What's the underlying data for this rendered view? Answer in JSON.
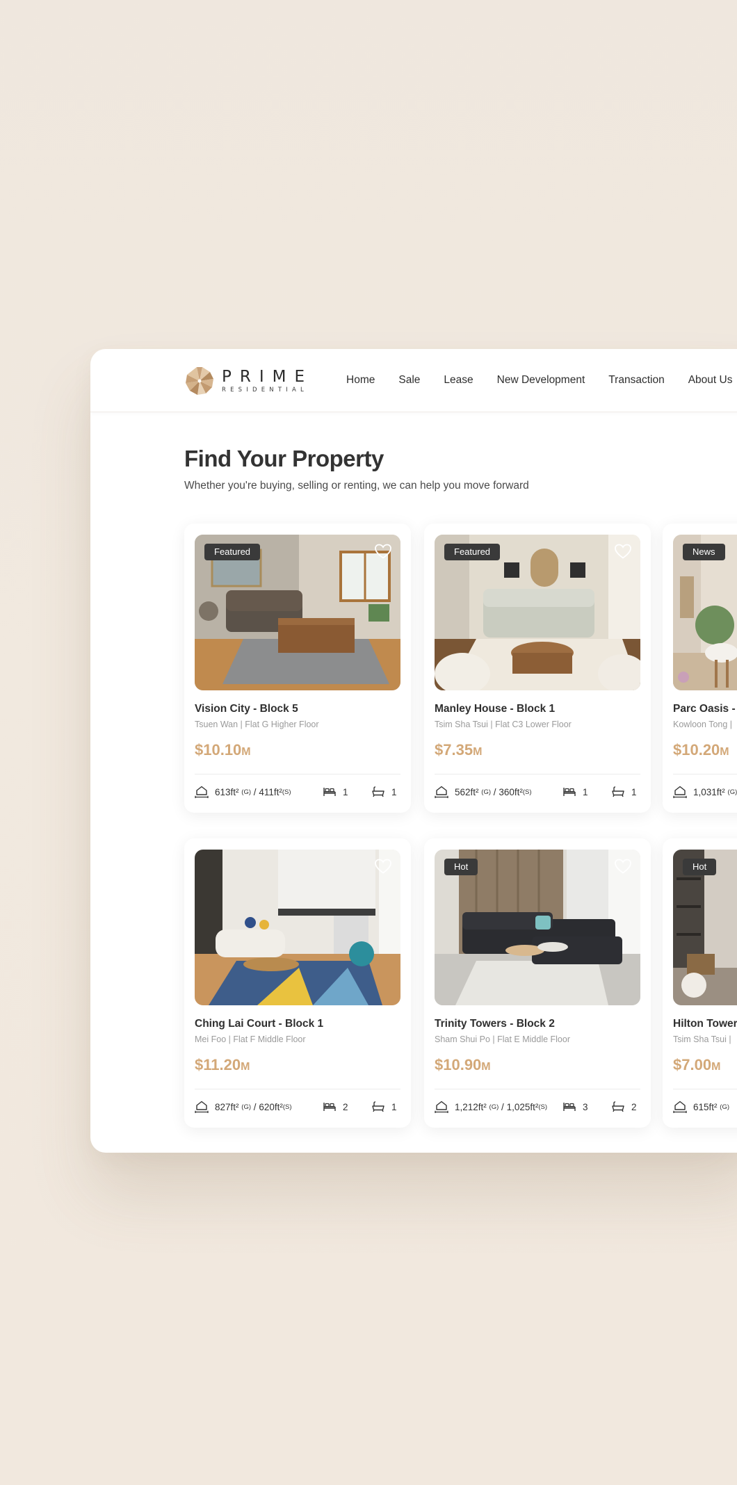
{
  "brand": {
    "name": "PRIME",
    "tagline": "RESIDENTIAL"
  },
  "nav": [
    "Home",
    "Sale",
    "Lease",
    "New Development",
    "Transaction",
    "About Us"
  ],
  "hero": {
    "title": "Find Your Property",
    "subtitle": "Whether you're buying, selling or renting, we can help you move forward"
  },
  "colors": {
    "accent": "#d3a878",
    "badge": "#3a3a3a",
    "text": "#2f2f2f",
    "muted": "#9a9a9a"
  },
  "listings": [
    {
      "badge": "Featured",
      "title": "Vision City - Block 5",
      "location": "Tsuen Wan | Flat G Higher Floor",
      "price": "$10.10",
      "unit": "M",
      "gross": "613ft²",
      "saleable": "411ft²",
      "beds": "1",
      "baths": "1"
    },
    {
      "badge": "Featured",
      "title": "Manley House - Block 1",
      "location": "Tsim Sha Tsui | Flat C3 Lower Floor",
      "price": "$7.35",
      "unit": "M",
      "gross": "562ft²",
      "saleable": "360ft²",
      "beds": "1",
      "baths": "1"
    },
    {
      "badge": "News",
      "title": "Parc Oasis - I",
      "location": "Kowloon Tong |",
      "price": "$10.20",
      "unit": "M",
      "gross": "1,031ft²",
      "saleable": "",
      "beds": "",
      "baths": ""
    },
    {
      "badge": "",
      "title": "Ching Lai Court - Block 1",
      "location": "Mei Foo | Flat F Middle Floor",
      "price": "$11.20",
      "unit": "M",
      "gross": "827ft²",
      "saleable": "620ft²",
      "beds": "2",
      "baths": "1"
    },
    {
      "badge": "Hot",
      "title": "Trinity Towers - Block 2",
      "location": "Sham Shui Po | Flat E Middle Floor",
      "price": "$10.90",
      "unit": "M",
      "gross": "1,212ft²",
      "saleable": "1,025ft²",
      "beds": "3",
      "baths": "2"
    },
    {
      "badge": "Hot",
      "title": "Hilton Towers",
      "location": "Tsim Sha Tsui |",
      "price": "$7.00",
      "unit": "M",
      "gross": "615ft²",
      "saleable": "",
      "beds": "",
      "baths": ""
    }
  ],
  "labels": {
    "gross": "(G)",
    "saleable": "(S)",
    "sep": "/"
  },
  "icons": [
    "heart-icon",
    "area-icon",
    "bed-icon",
    "bath-icon"
  ]
}
